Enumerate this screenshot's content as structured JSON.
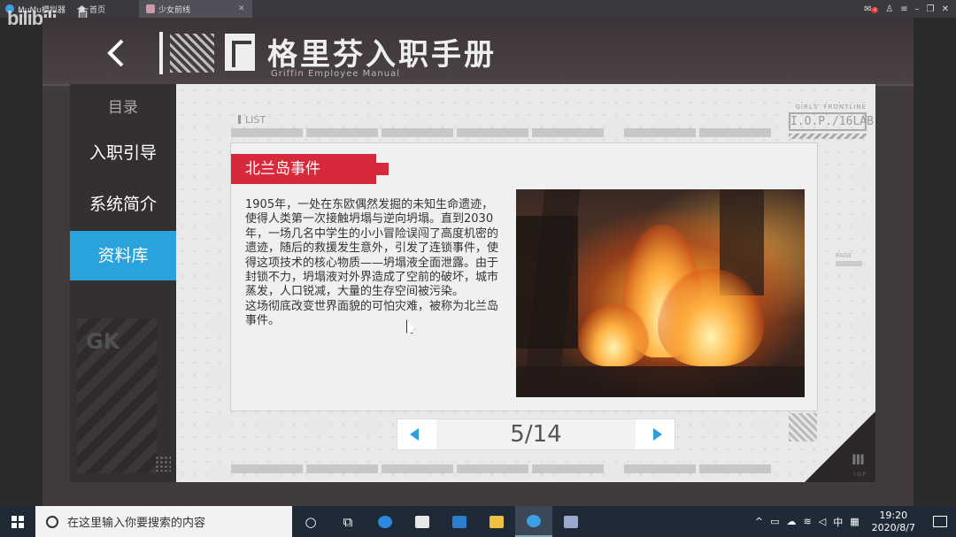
{
  "emulator": {
    "app_name": "MuMu模拟器",
    "tabs": [
      {
        "label": "首页",
        "active": false
      },
      {
        "label": "少女前线",
        "active": true
      }
    ],
    "mail_badge": "4"
  },
  "watermark": {
    "brand": "bilibili",
    "sub": "直播"
  },
  "header": {
    "title": "格里芬入职手册",
    "subtitle": "Griffin Employee Manual"
  },
  "sidebar": {
    "heading": "目录",
    "items": [
      {
        "label": "入职引导",
        "active": false
      },
      {
        "label": "系统简介",
        "active": false
      },
      {
        "label": "资料库",
        "active": true
      }
    ],
    "emblem": "GK"
  },
  "panel": {
    "list_label": "LIST",
    "logo_top": "GIRLS' FRONTLINE",
    "logo_main": "I.O.P./16LAB",
    "page_tag": "PAGE",
    "corner_sub": "I.O.P."
  },
  "card": {
    "title": "北兰岛事件",
    "body": "1905年，一处在东欧偶然发掘的未知生命遗迹，使得人类第一次接触坍塌与逆向坍塌。直到2030年，一场几名中学生的小小冒险误闯了高度机密的遗迹，随后的救援发生意外，引发了连锁事件，使得这项技术的核心物质——坍塌液全面泄露。由于封锁不力，坍塌液对外界造成了空前的破坏，城市蒸发，人口锐减，大量的生存空间被污染。\n这场彻底改变世界面貌的可怕灾难，被称为北兰岛事件。"
  },
  "pager": {
    "current": 5,
    "total": 14,
    "display": "5/14"
  },
  "taskbar": {
    "search_placeholder": "在这里输入你要搜索的内容",
    "ime": "中",
    "time": "19:20",
    "date": "2020/8/7"
  },
  "colors": {
    "accent_blue": "#2aa3dd",
    "tag_red": "#d6293b"
  }
}
